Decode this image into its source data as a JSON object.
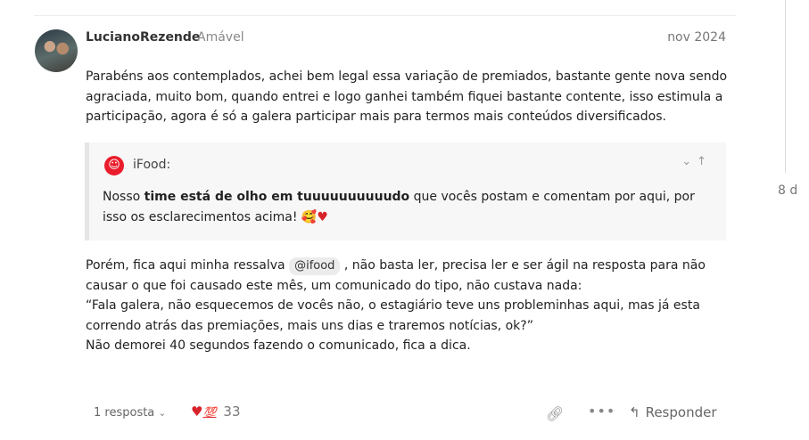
{
  "post": {
    "username": "LucianoRezende",
    "user_title": "Amável",
    "date": "nov 2024",
    "paragraph1": "Parabéns aos contemplados, achei bem legal essa variação de premiados, bastante gente nova sendo agraciada, muito bom, quando entrei e logo ganhei também fiquei bastante contente, isso estimula a participação, agora é só a galera participar mais para termos mais conteúdos diversificados.",
    "quote": {
      "author": "iFood:",
      "text_before": "Nosso ",
      "text_bold": "time está de olho em tuuuuuuuuuudo",
      "text_after": " que vocês postam e comentam por aqui, por isso os esclarecimentos acima! ",
      "emoji1": "🥰",
      "emoji2": "♥"
    },
    "paragraph2_before": "Porém, fica aqui minha ressalva ",
    "mention": "@ifood",
    "paragraph2_after": " , não basta ler, precisa ler e ser ágil na resposta para não causar o que foi causado este mês, um comunicado do tipo, não custava nada:",
    "paragraph3": "“Fala galera, não esquecemos de vocês não, o estagiário teve uns probleminhas aqui, mas já esta correndo atrás das premiações, mais uns dias e traremos notícias, ok?”",
    "paragraph4": "Não demorei 40 segundos fazendo o comunicado, fica a dica."
  },
  "footer": {
    "replies_label": "1 resposta",
    "reaction_heart": "♥",
    "reaction_hundred": "💯",
    "reaction_count": "33",
    "reply_label": "Responder"
  },
  "timeline": {
    "date": "8 d"
  },
  "icons": {
    "quote_avatar": "ifood-logo-icon",
    "link": "link-icon",
    "more": "more-icon",
    "reply": "reply-arrow-icon"
  },
  "colors": {
    "ifood_red": "#ea1d2c",
    "heart_red": "#d8232a"
  }
}
